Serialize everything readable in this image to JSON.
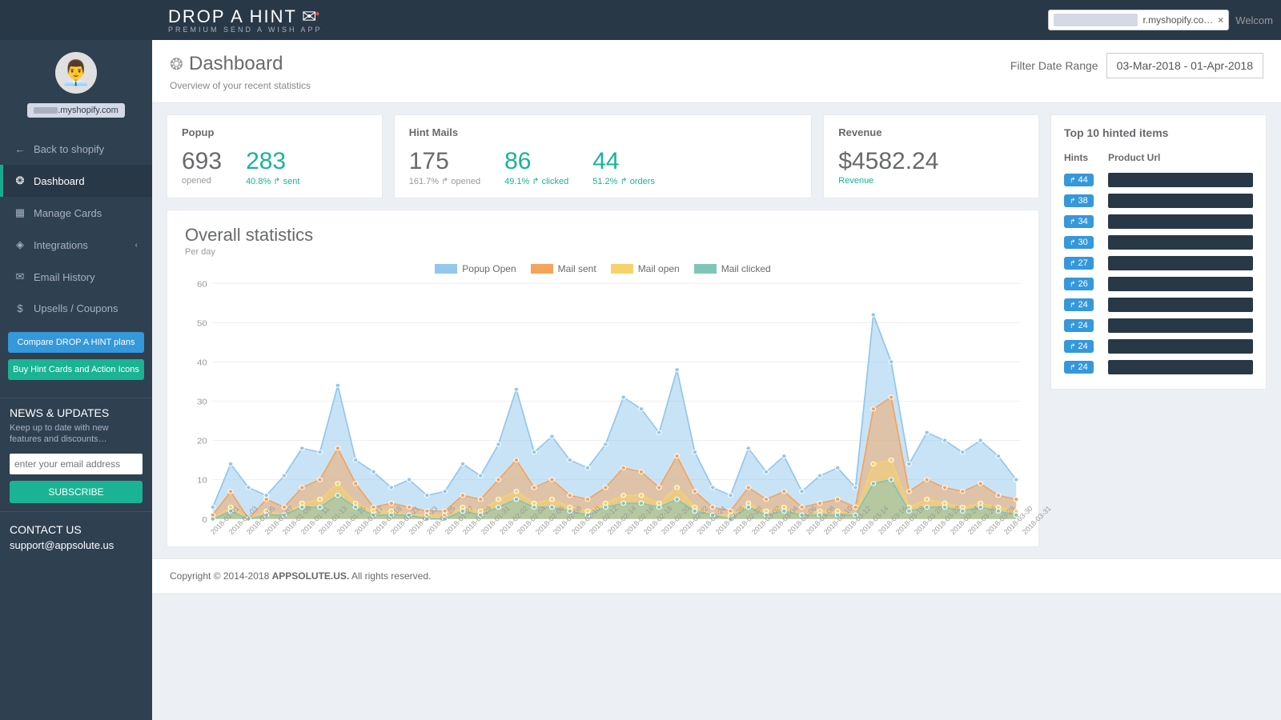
{
  "brand": {
    "name": "DROP A HINT",
    "tagline": "PREMIUM SEND A WISH APP"
  },
  "topbar": {
    "shop_suffix": "r.myshopify.co…",
    "welcome": "Welcom"
  },
  "profile": {
    "shop_suffix": ".myshopify.com"
  },
  "nav": {
    "back": "Back to shopify",
    "dashboard": "Dashboard",
    "manage": "Manage Cards",
    "integrations": "Integrations",
    "email": "Email History",
    "upsells": "Upsells / Coupons"
  },
  "side_buttons": {
    "compare": "Compare DROP A HINT plans",
    "buy": "Buy Hint Cards and Action Icons"
  },
  "news": {
    "title": "NEWS & UPDATES",
    "body": "Keep up to date with new features and discounts…",
    "placeholder": "enter your email address",
    "subscribe": "SUBSCRIBE"
  },
  "contact": {
    "title": "CONTACT US",
    "email": "support@appsolute.us"
  },
  "page": {
    "title": "Dashboard",
    "subtitle": "Overview of your recent statistics"
  },
  "filter": {
    "label": "Filter Date Range",
    "value": "03-Mar-2018 - 01-Apr-2018"
  },
  "cards": {
    "popup": {
      "title": "Popup",
      "opened_n": "693",
      "opened_l": "opened",
      "sent_n": "283",
      "sent_l": "40.8% ↱ sent"
    },
    "hint": {
      "title": "Hint Mails",
      "opened_n": "175",
      "opened_l": "161.7% ↱ opened",
      "clicked_n": "86",
      "clicked_l": "49.1% ↱ clicked",
      "orders_n": "44",
      "orders_l": "51.2% ↱ orders"
    },
    "rev": {
      "title": "Revenue",
      "value": "$4582.24",
      "label": "Revenue"
    }
  },
  "chart": {
    "title": "Overall statistics",
    "per": "Per day",
    "legend": {
      "popup": "Popup Open",
      "sent": "Mail sent",
      "open": "Mail open",
      "click": "Mail clicked"
    },
    "yticks": [
      "0",
      "10",
      "20",
      "30",
      "40",
      "50",
      "60"
    ]
  },
  "chart_data": {
    "type": "line",
    "ylim": [
      0,
      60
    ],
    "categories": [
      "2018-01-01",
      "2018-01-03",
      "2018-01-05",
      "2018-01-07",
      "2018-01-09",
      "2018-01-11",
      "2018-01-13",
      "2018-01-15",
      "2018-01-17",
      "2018-01-19",
      "2018-01-21",
      "2018-01-23",
      "2018-01-25",
      "2018-01-27",
      "2018-01-29",
      "2018-01-31",
      "2018-02-02",
      "2018-02-04",
      "2018-02-06",
      "2018-02-08",
      "2018-02-10",
      "2018-02-12",
      "2018-02-14",
      "2018-02-16",
      "2018-02-18",
      "2018-02-20",
      "2018-02-22",
      "2018-02-24",
      "2018-02-26",
      "2018-02-28",
      "2018-03-02",
      "2018-03-04",
      "2018-03-06",
      "2018-03-08",
      "2018-03-10",
      "2018-03-12",
      "2018-03-14",
      "2018-03-16",
      "2018-03-18",
      "2018-03-20",
      "2018-03-22",
      "2018-03-24",
      "2018-03-26",
      "2018-03-28",
      "2018-03-30",
      "2018-03-31"
    ],
    "series": [
      {
        "name": "Popup Open",
        "color": "#93c7ed",
        "values": [
          3,
          14,
          8,
          6,
          11,
          18,
          17,
          34,
          15,
          12,
          8,
          10,
          6,
          7,
          14,
          11,
          19,
          33,
          17,
          21,
          15,
          13,
          19,
          31,
          28,
          22,
          38,
          17,
          8,
          6,
          18,
          12,
          16,
          7,
          11,
          13,
          8,
          52,
          40,
          14,
          22,
          20,
          17,
          20,
          16,
          10
        ]
      },
      {
        "name": "Mail sent",
        "color": "#f6a35c",
        "values": [
          1,
          7,
          0,
          5,
          3,
          8,
          10,
          18,
          9,
          3,
          4,
          3,
          2,
          2,
          6,
          5,
          10,
          15,
          8,
          10,
          6,
          5,
          8,
          13,
          12,
          8,
          16,
          7,
          3,
          2,
          8,
          5,
          7,
          3,
          4,
          5,
          3,
          28,
          31,
          7,
          10,
          8,
          7,
          9,
          6,
          5
        ]
      },
      {
        "name": "Mail open",
        "color": "#f7d26a",
        "values": [
          0,
          3,
          0,
          2,
          1,
          4,
          5,
          9,
          4,
          2,
          2,
          1,
          1,
          1,
          3,
          2,
          5,
          7,
          4,
          5,
          3,
          2,
          4,
          6,
          6,
          4,
          8,
          3,
          1,
          1,
          4,
          2,
          3,
          1,
          2,
          2,
          1,
          14,
          15,
          3,
          5,
          4,
          3,
          4,
          3,
          2
        ]
      },
      {
        "name": "Mail clicked",
        "color": "#7fc6b6",
        "values": [
          0,
          2,
          0,
          1,
          1,
          3,
          3,
          6,
          3,
          1,
          1,
          1,
          0,
          0,
          2,
          1,
          3,
          5,
          3,
          3,
          2,
          1,
          3,
          4,
          4,
          3,
          5,
          2,
          1,
          0,
          3,
          1,
          2,
          1,
          1,
          1,
          1,
          9,
          10,
          2,
          3,
          3,
          2,
          3,
          2,
          1
        ]
      }
    ]
  },
  "top10": {
    "title": "Top 10 hinted items",
    "headers": {
      "hints": "Hints",
      "url": "Product Url"
    },
    "rows": [
      44,
      38,
      34,
      30,
      27,
      26,
      24,
      24,
      24,
      24
    ]
  },
  "footer": {
    "copy": "Copyright © 2014-2018 ",
    "brand": "APPSOLUTE.US.",
    "rest": " All rights reserved."
  }
}
